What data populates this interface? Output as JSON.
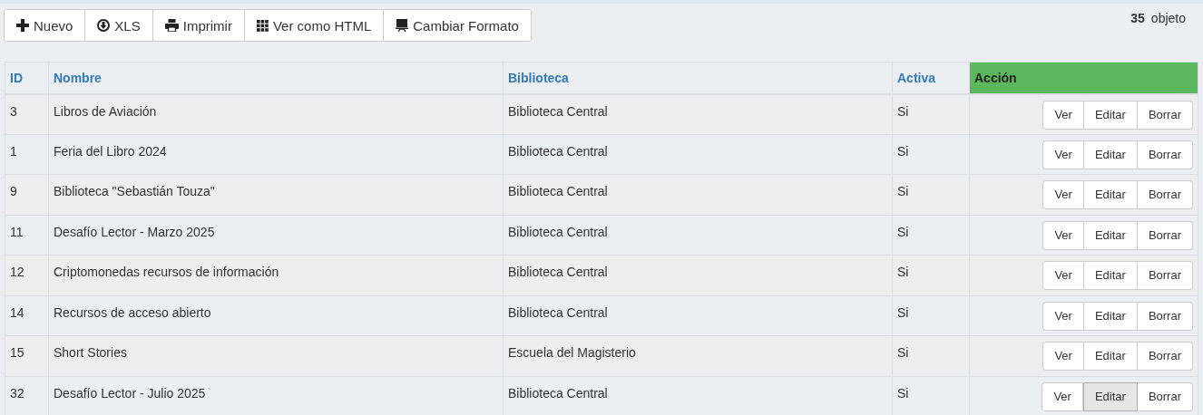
{
  "toolbar": [
    {
      "label": "Nuevo",
      "kind": "plus"
    },
    {
      "label": "XLS",
      "kind": "download"
    },
    {
      "label": "Imprimir",
      "kind": "print"
    },
    {
      "label": "Ver como HTML",
      "kind": "grid"
    },
    {
      "label": "Cambiar Formato",
      "kind": "monitor"
    }
  ],
  "count": {
    "number": "35",
    "label": "objeto"
  },
  "table": {
    "columns": [
      "ID",
      "Nombre",
      "Biblioteca",
      "Activa",
      "Acción"
    ],
    "rows": [
      {
        "cells": [
          "3",
          "Libros de Aviación",
          "Biblioteca Central",
          "Si"
        ],
        "actions": [
          {
            "label": "Ver",
            "highlighted": false
          },
          {
            "label": "Editar",
            "highlighted": false
          },
          {
            "label": "Borrar",
            "highlighted": false
          }
        ]
      },
      {
        "cells": [
          "1",
          "Feria del Libro 2024",
          "Biblioteca Central",
          "Si"
        ],
        "actions": [
          {
            "label": "Ver",
            "highlighted": false
          },
          {
            "label": "Editar",
            "highlighted": false
          },
          {
            "label": "Borrar",
            "highlighted": false
          }
        ]
      },
      {
        "cells": [
          "9",
          "Biblioteca \"Sebastián Touza\"",
          "Biblioteca Central",
          "Si"
        ],
        "actions": [
          {
            "label": "Ver",
            "highlighted": false
          },
          {
            "label": "Editar",
            "highlighted": false
          },
          {
            "label": "Borrar",
            "highlighted": false
          }
        ]
      },
      {
        "cells": [
          "11",
          "Desafío Lector - Marzo 2025",
          "Biblioteca Central",
          "Si"
        ],
        "actions": [
          {
            "label": "Ver",
            "highlighted": false
          },
          {
            "label": "Editar",
            "highlighted": false
          },
          {
            "label": "Borrar",
            "highlighted": false
          }
        ]
      },
      {
        "cells": [
          "12",
          "Criptomonedas recursos de información",
          "Biblioteca Central",
          "Si"
        ],
        "actions": [
          {
            "label": "Ver",
            "highlighted": false
          },
          {
            "label": "Editar",
            "highlighted": false
          },
          {
            "label": "Borrar",
            "highlighted": false
          }
        ]
      },
      {
        "cells": [
          "14",
          "Recursos de acceso abierto",
          "Biblioteca Central",
          "Si"
        ],
        "actions": [
          {
            "label": "Ver",
            "highlighted": false
          },
          {
            "label": "Editar",
            "highlighted": false
          },
          {
            "label": "Borrar",
            "highlighted": false
          }
        ]
      },
      {
        "cells": [
          "15",
          "Short Stories",
          "Escuela del Magisterio",
          "Si"
        ],
        "actions": [
          {
            "label": "Ver",
            "highlighted": false
          },
          {
            "label": "Editar",
            "highlighted": false
          },
          {
            "label": "Borrar",
            "highlighted": false
          }
        ]
      },
      {
        "cells": [
          "32",
          "Desafío Lector - Julio 2025",
          "Biblioteca Central",
          "Si"
        ],
        "actions": [
          {
            "label": "Ver",
            "highlighted": false
          },
          {
            "label": "Editar",
            "highlighted": true
          },
          {
            "label": "Borrar",
            "highlighted": false
          }
        ]
      }
    ]
  }
}
